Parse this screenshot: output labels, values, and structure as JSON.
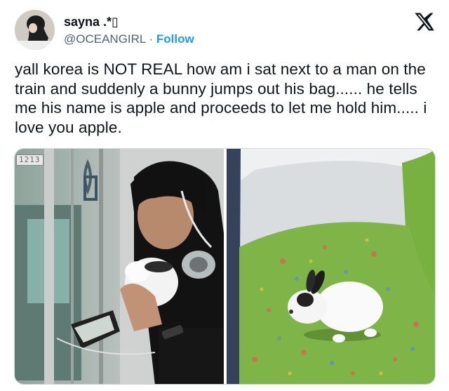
{
  "author": {
    "display_name": "sayna .*▯",
    "handle": "@OCEANGIRL",
    "separator": "·",
    "follow_label": "Follow"
  },
  "tweet": {
    "text": "yall korea is NOT REAL how am i sat next to a man on the train and suddenly a bunny jumps out his bag...... he tells me his name is apple and proceeds to let me hold him..... i love you apple."
  },
  "media": {
    "left_photo_badge": "1213",
    "left_photo_subject": "man on train holding white bunny",
    "right_photo_subject": "white bunny sitting on green train seat"
  },
  "icons": {
    "brand": "x-logo-icon"
  },
  "colors": {
    "text": "#0f1419",
    "secondary": "#536471",
    "link": "#1d9bf0",
    "seat_green": "#7fb548"
  }
}
